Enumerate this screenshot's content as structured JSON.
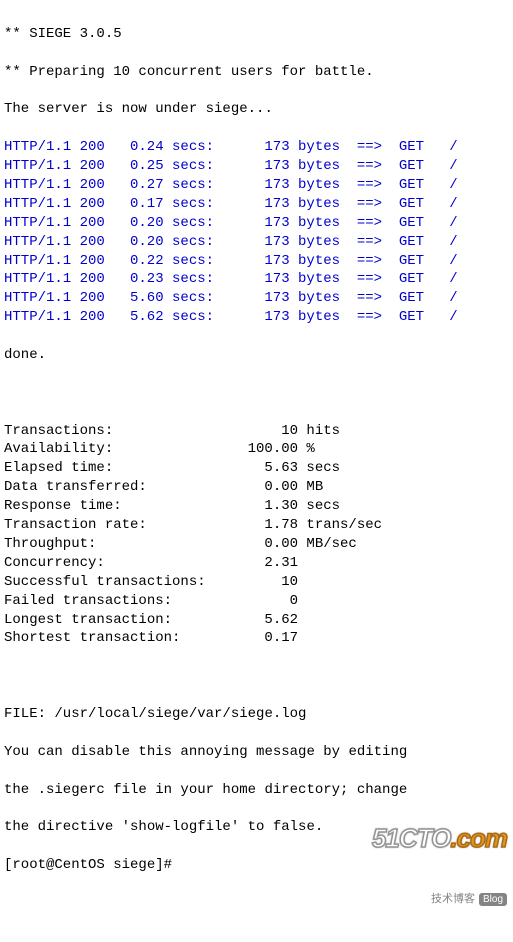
{
  "header": {
    "line1": "** SIEGE 3.0.5",
    "line2": "** Preparing 10 concurrent users for battle.",
    "line3": "The server is now under siege..."
  },
  "requests": [
    {
      "proto": "HTTP/1.1",
      "status": "200",
      "secs": "0.24",
      "secs_lb": "secs:",
      "bytes": "173",
      "bytes_lb": "bytes",
      "arrow": "==>",
      "method": "GET",
      "path": "/"
    },
    {
      "proto": "HTTP/1.1",
      "status": "200",
      "secs": "0.25",
      "secs_lb": "secs:",
      "bytes": "173",
      "bytes_lb": "bytes",
      "arrow": "==>",
      "method": "GET",
      "path": "/"
    },
    {
      "proto": "HTTP/1.1",
      "status": "200",
      "secs": "0.27",
      "secs_lb": "secs:",
      "bytes": "173",
      "bytes_lb": "bytes",
      "arrow": "==>",
      "method": "GET",
      "path": "/"
    },
    {
      "proto": "HTTP/1.1",
      "status": "200",
      "secs": "0.17",
      "secs_lb": "secs:",
      "bytes": "173",
      "bytes_lb": "bytes",
      "arrow": "==>",
      "method": "GET",
      "path": "/"
    },
    {
      "proto": "HTTP/1.1",
      "status": "200",
      "secs": "0.20",
      "secs_lb": "secs:",
      "bytes": "173",
      "bytes_lb": "bytes",
      "arrow": "==>",
      "method": "GET",
      "path": "/"
    },
    {
      "proto": "HTTP/1.1",
      "status": "200",
      "secs": "0.20",
      "secs_lb": "secs:",
      "bytes": "173",
      "bytes_lb": "bytes",
      "arrow": "==>",
      "method": "GET",
      "path": "/"
    },
    {
      "proto": "HTTP/1.1",
      "status": "200",
      "secs": "0.22",
      "secs_lb": "secs:",
      "bytes": "173",
      "bytes_lb": "bytes",
      "arrow": "==>",
      "method": "GET",
      "path": "/"
    },
    {
      "proto": "HTTP/1.1",
      "status": "200",
      "secs": "0.23",
      "secs_lb": "secs:",
      "bytes": "173",
      "bytes_lb": "bytes",
      "arrow": "==>",
      "method": "GET",
      "path": "/"
    },
    {
      "proto": "HTTP/1.1",
      "status": "200",
      "secs": "5.60",
      "secs_lb": "secs:",
      "bytes": "173",
      "bytes_lb": "bytes",
      "arrow": "==>",
      "method": "GET",
      "path": "/"
    },
    {
      "proto": "HTTP/1.1",
      "status": "200",
      "secs": "5.62",
      "secs_lb": "secs:",
      "bytes": "173",
      "bytes_lb": "bytes",
      "arrow": "==>",
      "method": "GET",
      "path": "/"
    }
  ],
  "done": "done.",
  "stats": [
    {
      "label": "Transactions:",
      "value": "10",
      "unit": "hits"
    },
    {
      "label": "Availability:",
      "value": "100.00",
      "unit": "%"
    },
    {
      "label": "Elapsed time:",
      "value": "5.63",
      "unit": "secs"
    },
    {
      "label": "Data transferred:",
      "value": "0.00",
      "unit": "MB"
    },
    {
      "label": "Response time:",
      "value": "1.30",
      "unit": "secs"
    },
    {
      "label": "Transaction rate:",
      "value": "1.78",
      "unit": "trans/sec"
    },
    {
      "label": "Throughput:",
      "value": "0.00",
      "unit": "MB/sec"
    },
    {
      "label": "Concurrency:",
      "value": "2.31",
      "unit": ""
    },
    {
      "label": "Successful transactions:",
      "value": "10",
      "unit": ""
    },
    {
      "label": "Failed transactions:",
      "value": "0",
      "unit": ""
    },
    {
      "label": "Longest transaction:",
      "value": "5.62",
      "unit": ""
    },
    {
      "label": "Shortest transaction:",
      "value": "0.17",
      "unit": ""
    }
  ],
  "footer": {
    "file": "FILE: /usr/local/siege/var/siege.log",
    "msg1": "You can disable this annoying message by editing",
    "msg2": "the .siegerc file in your home directory; change",
    "msg3": "the directive 'show-logfile' to false.",
    "prompt": "[root@CentOS siege]#"
  },
  "watermark": {
    "sub": "技术博客",
    "blog": "Blog"
  }
}
